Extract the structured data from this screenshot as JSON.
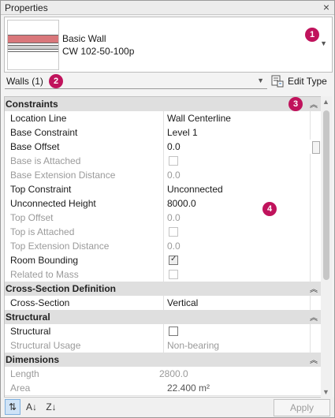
{
  "window": {
    "title": "Properties",
    "close": "×"
  },
  "type_selector": {
    "family": "Basic Wall",
    "type": "CW 102-50-100p"
  },
  "filter": {
    "selected": "Walls (1)",
    "edit_type_label": "Edit Type"
  },
  "badges": {
    "b1": "1",
    "b2": "2",
    "b3": "3",
    "b4": "4"
  },
  "groups": {
    "constraints": "Constraints",
    "cross_section": "Cross-Section Definition",
    "structural": "Structural",
    "dimensions": "Dimensions"
  },
  "rows": [
    {
      "key": "Location Line",
      "value": "Wall Centerline"
    },
    {
      "key": "Base Constraint",
      "value": "Level 1"
    },
    {
      "key": "Base Offset",
      "value": "0.0"
    },
    {
      "key": "Base is Attached",
      "value": ""
    },
    {
      "key": "Base Extension Distance",
      "value": "0.0"
    },
    {
      "key": "Top Constraint",
      "value": "Unconnected"
    },
    {
      "key": "Unconnected Height",
      "value": "8000.0"
    },
    {
      "key": "Top Offset",
      "value": "0.0"
    },
    {
      "key": "Top is Attached",
      "value": ""
    },
    {
      "key": "Top Extension Distance",
      "value": "0.0"
    },
    {
      "key": "Room Bounding",
      "value": ""
    },
    {
      "key": "Related to Mass",
      "value": ""
    },
    {
      "key": "Cross-Section",
      "value": "Vertical"
    },
    {
      "key": "Structural",
      "value": ""
    },
    {
      "key": "Structural Usage",
      "value": "Non-bearing"
    },
    {
      "key": "Length",
      "value": "2800.0"
    },
    {
      "key": "Area",
      "value": "22.400 m²"
    }
  ],
  "toolbar": {
    "apply": "Apply"
  }
}
